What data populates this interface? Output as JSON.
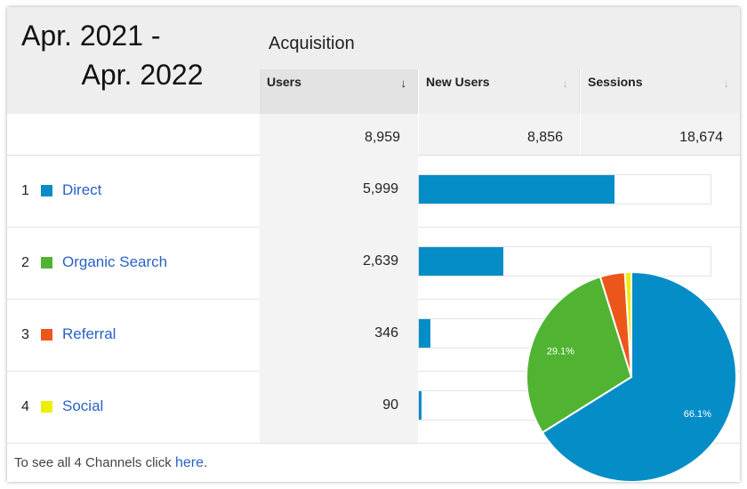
{
  "date_range": {
    "line1": "Apr. 2021 -",
    "line2": "Apr. 2022"
  },
  "group_header": "Acquisition",
  "columns": [
    {
      "label": "Users",
      "sorted": true
    },
    {
      "label": "New Users",
      "sorted": false
    },
    {
      "label": "Sessions",
      "sorted": false
    }
  ],
  "totals": {
    "users": "8,959",
    "new_users": "8,856",
    "sessions": "18,674"
  },
  "rows": [
    {
      "rank": "1",
      "channel": "Direct",
      "users": "5,999",
      "color": "#058dc7",
      "bar_fraction": 0.67
    },
    {
      "rank": "2",
      "channel": "Organic Search",
      "users": "2,639",
      "color": "#50b432",
      "bar_fraction": 0.29
    },
    {
      "rank": "3",
      "channel": "Referral",
      "users": "346",
      "color": "#ed561b",
      "bar_fraction": 0.039
    },
    {
      "rank": "4",
      "channel": "Social",
      "users": "90",
      "color": "#edef00",
      "bar_fraction": 0.01
    }
  ],
  "footer": {
    "prefix": "To see all 4 Channels click ",
    "link": "here",
    "suffix": "."
  },
  "chart_data": {
    "type": "pie",
    "categories": [
      "Direct",
      "Organic Search",
      "Referral",
      "Social"
    ],
    "values": [
      5999,
      2639,
      346,
      90
    ],
    "labels": [
      "66.1%",
      "29.1%",
      "",
      ""
    ],
    "colors": [
      "#058dc7",
      "#50b432",
      "#ed561b",
      "#edef00"
    ]
  }
}
